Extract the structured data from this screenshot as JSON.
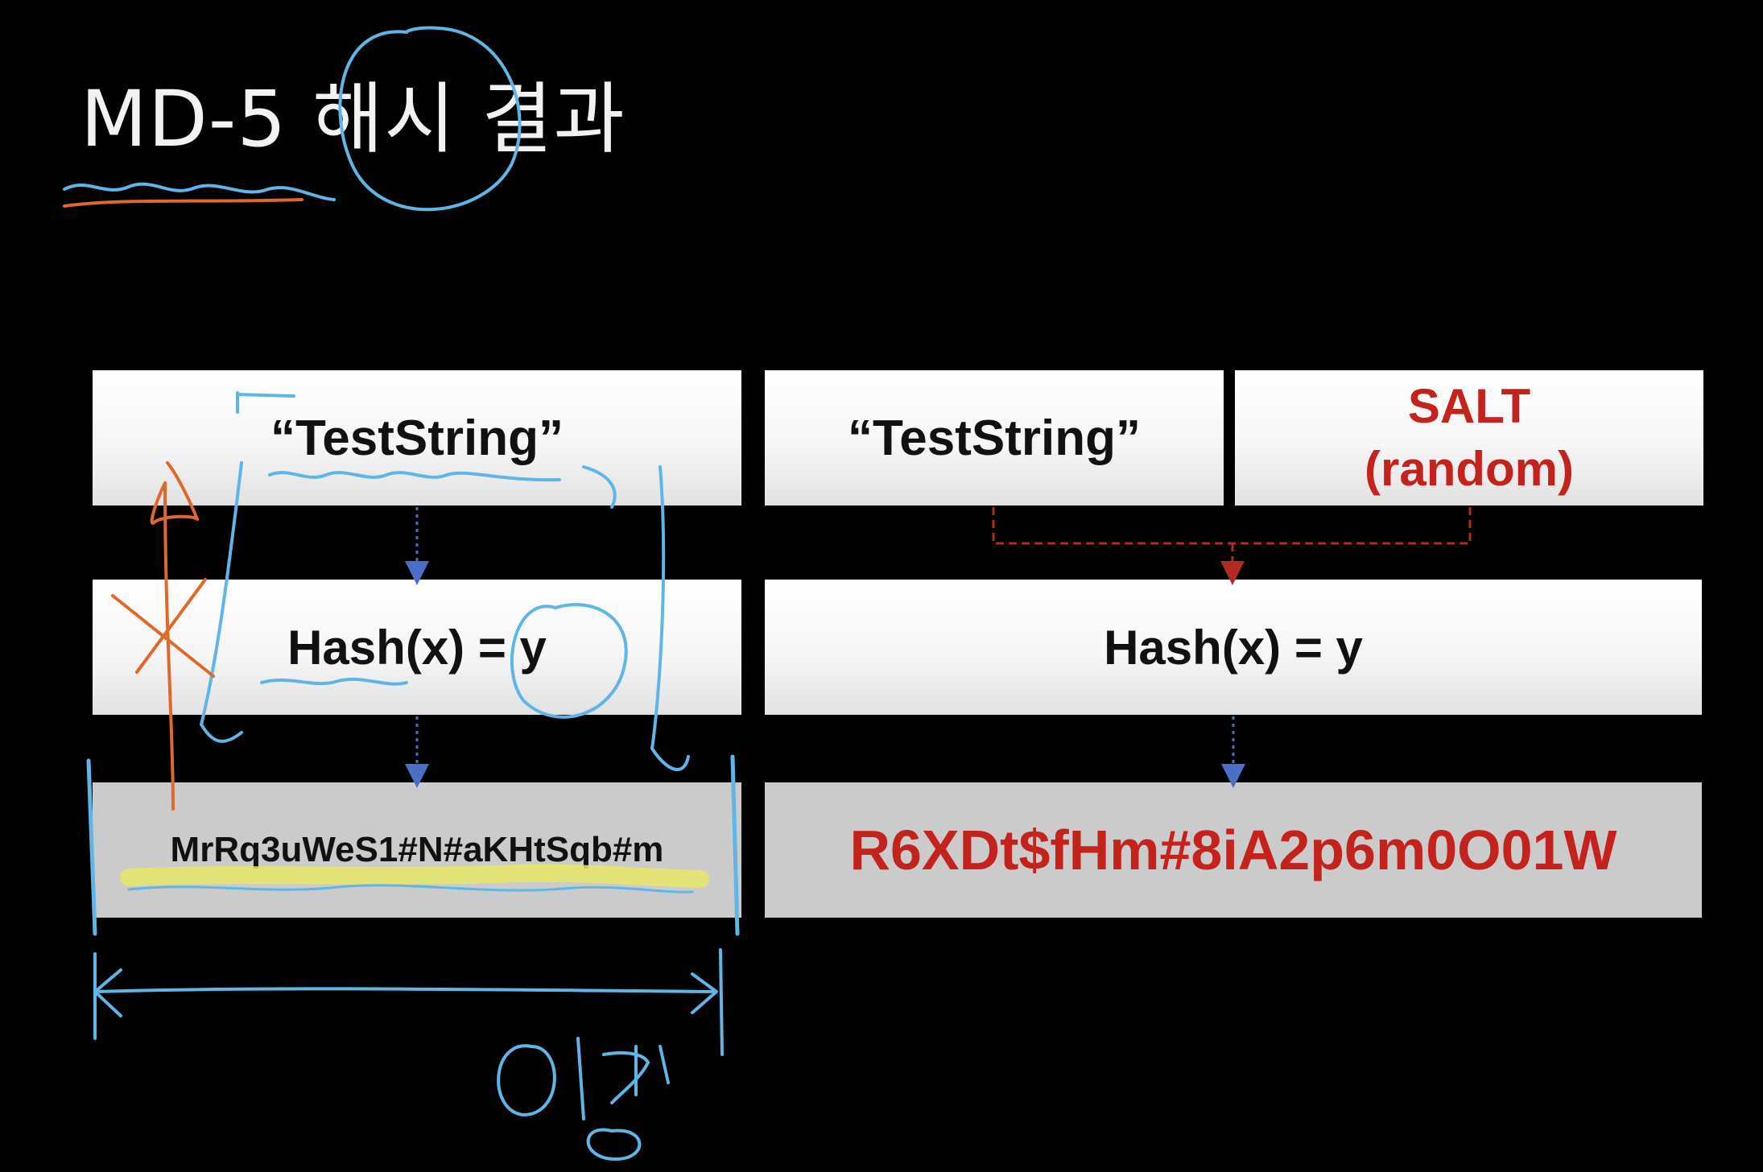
{
  "title": "MD-5 해시 결과",
  "left": {
    "input": "“TestString”",
    "function": "Hash(x) = y",
    "output": "MrRq3uWeS1#N#aKHtSqb#m"
  },
  "right": {
    "input": "“TestString”",
    "salt_line1": "SALT",
    "salt_line2": "(random)",
    "function": "Hash(x) = y",
    "output": "R6XDt$fHm#8iA2p6m0O01W"
  },
  "annotation": {
    "handwritten_note": "일정"
  },
  "colors": {
    "background": "#000000",
    "salt_red": "#c4221c",
    "arrow_blue": "#4a6fc4",
    "arrow_red": "#b22a22",
    "ink_blue": "#5fb6e6",
    "ink_orange": "#e0682a",
    "highlight_yellow": "#e8e86a"
  }
}
